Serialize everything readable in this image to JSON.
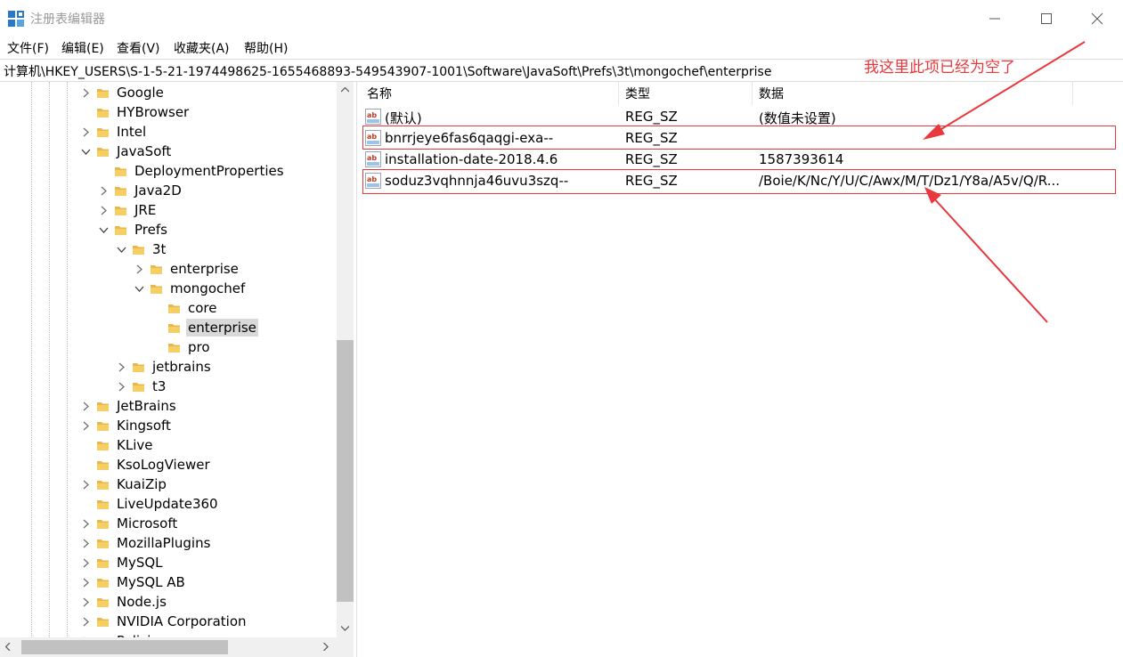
{
  "window": {
    "title": "注册表编辑器",
    "controls": {
      "minimize": "—",
      "maximize": "☐",
      "close": "✕"
    }
  },
  "menu": [
    "文件(F)",
    "编辑(E)",
    "查看(V)",
    "收藏夹(A)",
    "帮助(H)"
  ],
  "address": "计算机\\HKEY_USERS\\S-1-5-21-1974498625-1655468893-549543907-1001\\Software\\JavaSoft\\Prefs\\3t\\mongochef\\enterprise",
  "tree": {
    "nodes": [
      {
        "label": "Google",
        "level": 0,
        "expander": "collapsed"
      },
      {
        "label": "HYBrowser",
        "level": 0,
        "expander": "none"
      },
      {
        "label": "Intel",
        "level": 0,
        "expander": "collapsed"
      },
      {
        "label": "JavaSoft",
        "level": 0,
        "expander": "expanded"
      },
      {
        "label": "DeploymentProperties",
        "level": 1,
        "expander": "none"
      },
      {
        "label": "Java2D",
        "level": 1,
        "expander": "collapsed"
      },
      {
        "label": "JRE",
        "level": 1,
        "expander": "collapsed"
      },
      {
        "label": "Prefs",
        "level": 1,
        "expander": "expanded"
      },
      {
        "label": "3t",
        "level": 2,
        "expander": "expanded"
      },
      {
        "label": "enterprise",
        "level": 3,
        "expander": "collapsed"
      },
      {
        "label": "mongochef",
        "level": 3,
        "expander": "expanded"
      },
      {
        "label": "core",
        "level": 4,
        "expander": "none"
      },
      {
        "label": "enterprise",
        "level": 4,
        "expander": "none",
        "selected": true
      },
      {
        "label": "pro",
        "level": 4,
        "expander": "none"
      },
      {
        "label": "jetbrains",
        "level": 2,
        "expander": "collapsed"
      },
      {
        "label": "t3",
        "level": 2,
        "expander": "collapsed"
      },
      {
        "label": "JetBrains",
        "level": 0,
        "expander": "collapsed"
      },
      {
        "label": "Kingsoft",
        "level": 0,
        "expander": "collapsed"
      },
      {
        "label": "KLive",
        "level": 0,
        "expander": "none"
      },
      {
        "label": "KsoLogViewer",
        "level": 0,
        "expander": "none"
      },
      {
        "label": "KuaiZip",
        "level": 0,
        "expander": "collapsed"
      },
      {
        "label": "LiveUpdate360",
        "level": 0,
        "expander": "none"
      },
      {
        "label": "Microsoft",
        "level": 0,
        "expander": "collapsed"
      },
      {
        "label": "MozillaPlugins",
        "level": 0,
        "expander": "collapsed"
      },
      {
        "label": "MySQL",
        "level": 0,
        "expander": "collapsed"
      },
      {
        "label": "MySQL AB",
        "level": 0,
        "expander": "collapsed"
      },
      {
        "label": "Node.js",
        "level": 0,
        "expander": "collapsed"
      },
      {
        "label": "NVIDIA Corporation",
        "level": 0,
        "expander": "collapsed"
      },
      {
        "label": "Policies",
        "level": 0,
        "expander": "collapsed"
      }
    ]
  },
  "values": {
    "headers": [
      "名称",
      "类型",
      "数据"
    ],
    "rows": [
      {
        "name": "(默认)",
        "type": "REG_SZ",
        "data": "(数值未设置)",
        "icon": "ab"
      },
      {
        "name": "bnrrjeye6fas6qaqgi-exa--",
        "type": "REG_SZ",
        "data": "",
        "icon": "ab"
      },
      {
        "name": "installation-date-2018.4.6",
        "type": "REG_SZ",
        "data": "1587393614",
        "icon": "ab"
      },
      {
        "name": "soduz3vqhnnja46uvu3szq--",
        "type": "REG_SZ",
        "data": "/Boie/K/Nc/Y/U/C/Awx/M/T/Dz1/Y8a/A5v/Q/R...",
        "icon": "ab"
      }
    ]
  },
  "annotation": "我这里此项已经为空了",
  "colors": {
    "annotation": "#e8383d",
    "folder": "#e9b84a",
    "selection": "#d9d9d9",
    "icon": "#c0392b"
  }
}
